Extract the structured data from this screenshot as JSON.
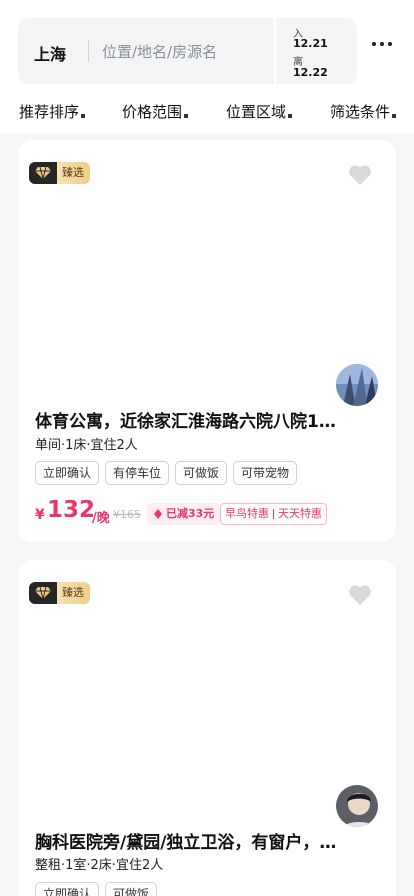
{
  "header": {
    "city": "上海",
    "search_placeholder": "位置/地名/房源名",
    "checkin_label": "入",
    "checkin_date": "12.21",
    "checkout_label": "离",
    "checkout_date": "12.22",
    "more_icon": "more-dots-icon"
  },
  "filters": [
    {
      "label": "推荐排序"
    },
    {
      "label": "价格范围"
    },
    {
      "label": "位置区域"
    },
    {
      "label": "筛选条件"
    }
  ],
  "listings": [
    {
      "badge": "臻选",
      "title": "体育公寓，近徐家汇淮海路六院八院1…",
      "subtitle": "单间·1床·宜住2人",
      "tags": [
        "立即确认",
        "有停车位",
        "可做饭",
        "可带宠物"
      ],
      "currency": "¥",
      "price": "132",
      "per_night": "/晚",
      "original_price": "¥165",
      "discount": "已减33元",
      "promos": [
        "早鸟特惠",
        "天天特惠"
      ]
    },
    {
      "badge": "臻选",
      "title": "胸科医院旁/黛园/独立卫浴，有窗户，…",
      "subtitle": "整租·1室·2床·宜住2人",
      "tags": [
        "立即确认",
        "可做饭"
      ]
    }
  ],
  "colors": {
    "accent": "#e8386b",
    "badge_gold": "#f1cd8a",
    "badge_dark": "#262626"
  }
}
